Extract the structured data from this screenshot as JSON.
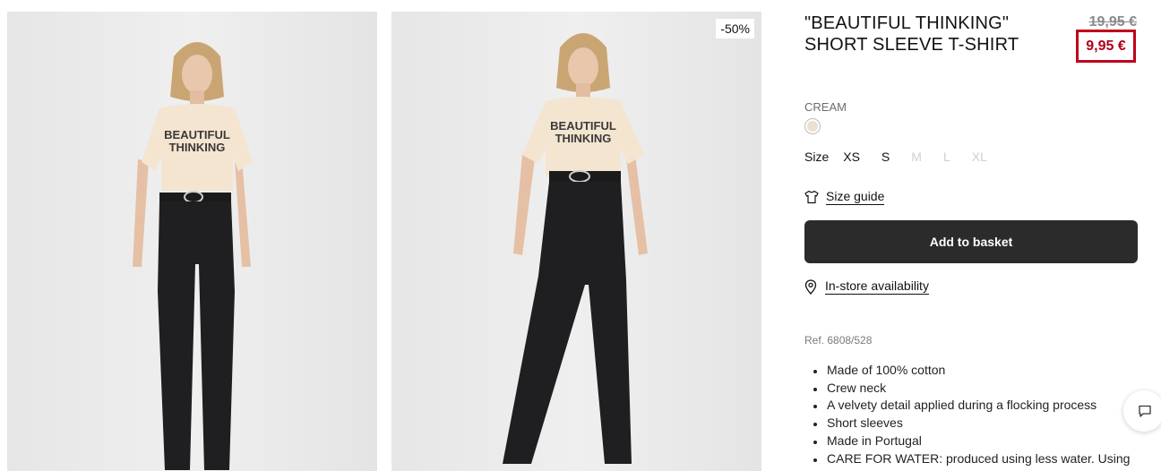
{
  "product": {
    "title": "\"BEAUTIFUL THINKING\" SHORT SLEEVE T-SHIRT",
    "original_price": "19,95 €",
    "sale_price": "9,95 €",
    "discount_badge": "-50%",
    "color_name": "CREAM",
    "color_hex": "#ece0cf",
    "shirt_print": [
      "BEAUTIFUL",
      "THINKING"
    ],
    "size_label": "Size",
    "sizes": [
      {
        "label": "XS",
        "available": true
      },
      {
        "label": "S",
        "available": true
      },
      {
        "label": "M",
        "available": false
      },
      {
        "label": "L",
        "available": false
      },
      {
        "label": "XL",
        "available": false
      }
    ],
    "size_guide_label": "Size guide",
    "add_to_basket_label": "Add to basket",
    "instore_label": "In-store availability",
    "reference": "Ref. 6808/528",
    "features": [
      "Made of 100% cotton",
      "Crew neck",
      "A velvety detail applied during a flocking process",
      "Short sleeves",
      "Made in Portugal",
      "CARE FOR WATER: produced using less water. Using"
    ]
  },
  "colors": {
    "sale_red": "#b00018",
    "button_dark": "#2b2b2b",
    "photo_bg": "#e9e9e9"
  },
  "icons": [
    "t-shirt-icon",
    "location-pin-icon",
    "chat-icon"
  ]
}
